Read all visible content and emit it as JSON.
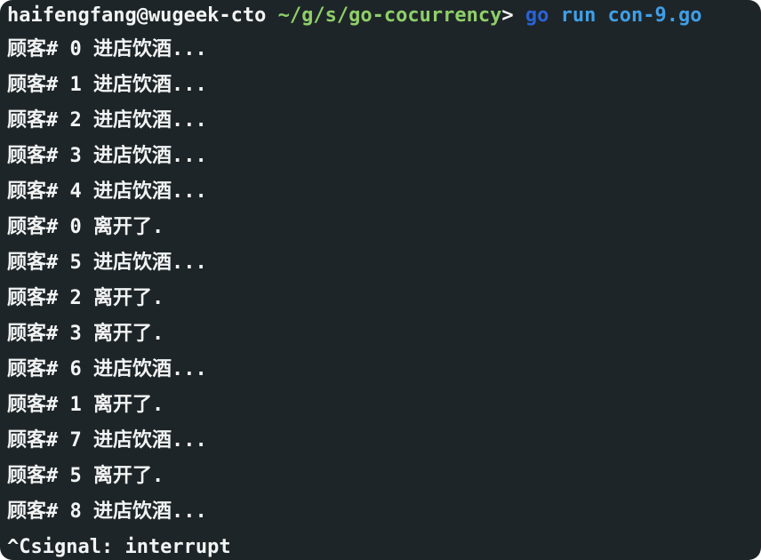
{
  "prompt": {
    "user_host": "haifengfang@wugeek-cto",
    "path": "~/g/s/go-cocurrency",
    "symbol": "> ",
    "command_go": "go",
    "command_args": " run con-9.go"
  },
  "output_lines": [
    "顾客# 0 进店饮酒...",
    "顾客# 1 进店饮酒...",
    "顾客# 2 进店饮酒...",
    "顾客# 3 进店饮酒...",
    "顾客# 4 进店饮酒...",
    "顾客# 0 离开了.",
    "顾客# 5 进店饮酒...",
    "顾客# 2 离开了.",
    "顾客# 3 离开了.",
    "顾客# 6 进店饮酒...",
    "顾客# 1 离开了.",
    "顾客# 7 进店饮酒...",
    "顾客# 5 离开了.",
    "顾客# 8 进店饮酒...",
    "^Csignal: interrupt"
  ],
  "colors": {
    "background": "#1e2528",
    "text": "#f2f4f4",
    "path": "#8fcf69",
    "command_go": "#2a62d6",
    "command_args": "#3f9fe8"
  }
}
